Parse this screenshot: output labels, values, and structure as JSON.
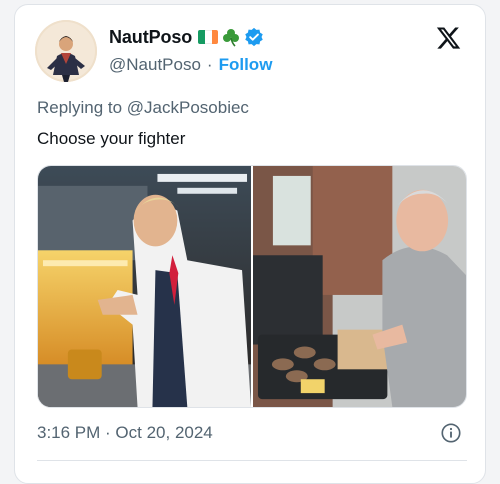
{
  "author": {
    "display_name": "NautPoso",
    "handle": "@NautPoso",
    "separator": "·",
    "follow_label": "Follow",
    "flag_colors": [
      "#169b62",
      "#ffffff",
      "#ff883e"
    ],
    "verified_color": "#1d9bf0",
    "avatar_icon": "avatar-icon"
  },
  "tweet": {
    "replying_to": "Replying to @JackPosobiec",
    "text": "Choose your fighter",
    "timestamp": "3:16 PM · Oct 20, 2024"
  },
  "media": {
    "left_photo": "man-in-apron-at-fry-station-photo",
    "right_photo": "man-grilling-burgers-photo"
  },
  "icons": {
    "brand": "x-logo-icon",
    "info": "info-icon"
  },
  "colors": {
    "link": "#1d9bf0",
    "text": "#0f1419",
    "muted": "#536471",
    "border": "#dfe3e8"
  }
}
